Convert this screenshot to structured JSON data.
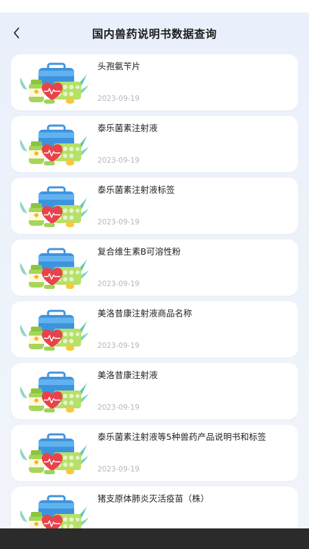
{
  "header": {
    "title": "国内兽药说明书数据查询"
  },
  "items": [
    {
      "title": "头孢氨苄片",
      "date": "2023-09-19"
    },
    {
      "title": "泰乐菌素注射液",
      "date": "2023-09-19"
    },
    {
      "title": "泰乐菌素注射液标签",
      "date": "2023-09-19"
    },
    {
      "title": "复合维生素B可溶性粉",
      "date": "2023-09-19"
    },
    {
      "title": "美洛昔康注射液商品名称",
      "date": "2023-09-19"
    },
    {
      "title": "美洛昔康注射液",
      "date": "2023-09-19"
    },
    {
      "title": "泰乐菌素注射液等5种兽药产品说明书和标签",
      "date": "2023-09-19"
    },
    {
      "title": "猪支原体肺炎灭活疫苗（株）",
      "date": ""
    }
  ],
  "icons": {
    "back": "chevron-left-icon",
    "thumbnail": "medicine-kit-icon"
  },
  "colors": {
    "background": "#eef1f8",
    "card": "#ffffff",
    "title_text": "#1d1d1d",
    "date_text": "#b3b6bd",
    "kit_blue": "#4aa3ea",
    "heart_red": "#e8434b",
    "pill_green": "#a9d85c",
    "leaf_teal": "#5ec8b0"
  }
}
